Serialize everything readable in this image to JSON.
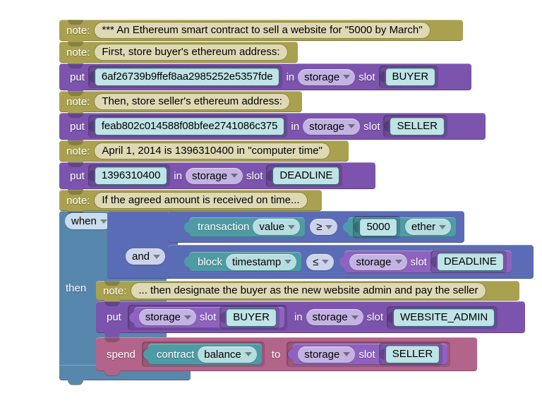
{
  "app": {
    "kind": "blockly-visual-editor",
    "subject": "Ethereum smart contract"
  },
  "colors": {
    "note": "#a9a14f",
    "note_field": "#ded9b4",
    "put": "#7c54ad",
    "spend": "#b3648a",
    "control": "#5887ae",
    "boolean": "#5a6cb5",
    "value_teal": "#4f9ba5",
    "value_purple": "#8f62c0",
    "field": "#bfe3e6",
    "dropdown_lavender": "#c3b3e2",
    "canvas": "#ffffff"
  },
  "labels": {
    "note": "note:",
    "put": "put",
    "in": "in",
    "slot": "slot",
    "then": "then",
    "spend": "spend",
    "to": "to"
  },
  "icons": {
    "dropdown": "chevron-down-icon"
  },
  "blocks": [
    {
      "id": "note-1",
      "type": "note",
      "label": "note:",
      "text": "*** An Ethereum smart contract to sell a website for \"5000 by March\""
    },
    {
      "id": "note-2",
      "type": "note",
      "label": "note:",
      "text": "First, store buyer's ethereum address:"
    },
    {
      "id": "put-1",
      "type": "put",
      "keyword": "put",
      "value": "6af26739b9ffef8aa2985252e5357fde",
      "in": "in",
      "scope": "storage",
      "slot_label": "slot",
      "slot": "BUYER"
    },
    {
      "id": "note-3",
      "type": "note",
      "label": "note:",
      "text": "Then, store seller's ethereum address:"
    },
    {
      "id": "put-2",
      "type": "put",
      "keyword": "put",
      "value": "feab802c014588f08bfee2741086c375",
      "in": "in",
      "scope": "storage",
      "slot_label": "slot",
      "slot": "SELLER"
    },
    {
      "id": "note-4",
      "type": "note",
      "label": "note:",
      "text": "April 1, 2014 is 1396310400 in \"computer time\""
    },
    {
      "id": "put-3",
      "type": "put",
      "keyword": "put",
      "value": "1396310400",
      "in": "in",
      "scope": "storage",
      "slot_label": "slot",
      "slot": "DEADLINE"
    },
    {
      "id": "note-5",
      "type": "note",
      "label": "note:",
      "text": "If the agreed amount is received on time..."
    }
  ],
  "control": {
    "when_label": "when",
    "then_label": "then",
    "conditions": [
      {
        "id": "cond-1",
        "joiner": null,
        "left_object": "transaction",
        "left_property": "value",
        "operator": "≥",
        "right_number": "5000",
        "right_unit": "ether"
      },
      {
        "id": "cond-2",
        "joiner": "and",
        "left_object": "block",
        "left_property": "timestamp",
        "operator": "≤",
        "right_scope": "storage",
        "right_slot_label": "slot",
        "right_slot": "DEADLINE"
      }
    ],
    "body": [
      {
        "id": "note-6",
        "type": "note",
        "label": "note:",
        "text": "... then designate the buyer as the new website admin and pay the seller"
      },
      {
        "id": "put-4",
        "type": "put",
        "keyword": "put",
        "source_scope": "storage",
        "source_slot_label": "slot",
        "source_slot": "BUYER",
        "in": "in",
        "dest_scope": "storage",
        "dest_slot_label": "slot",
        "dest_slot": "WEBSITE_ADMIN"
      },
      {
        "id": "spend-1",
        "type": "spend",
        "keyword": "spend",
        "source_object": "contract",
        "source_property": "balance",
        "to": "to",
        "dest_scope": "storage",
        "dest_slot_label": "slot",
        "dest_slot": "SELLER"
      }
    ]
  }
}
